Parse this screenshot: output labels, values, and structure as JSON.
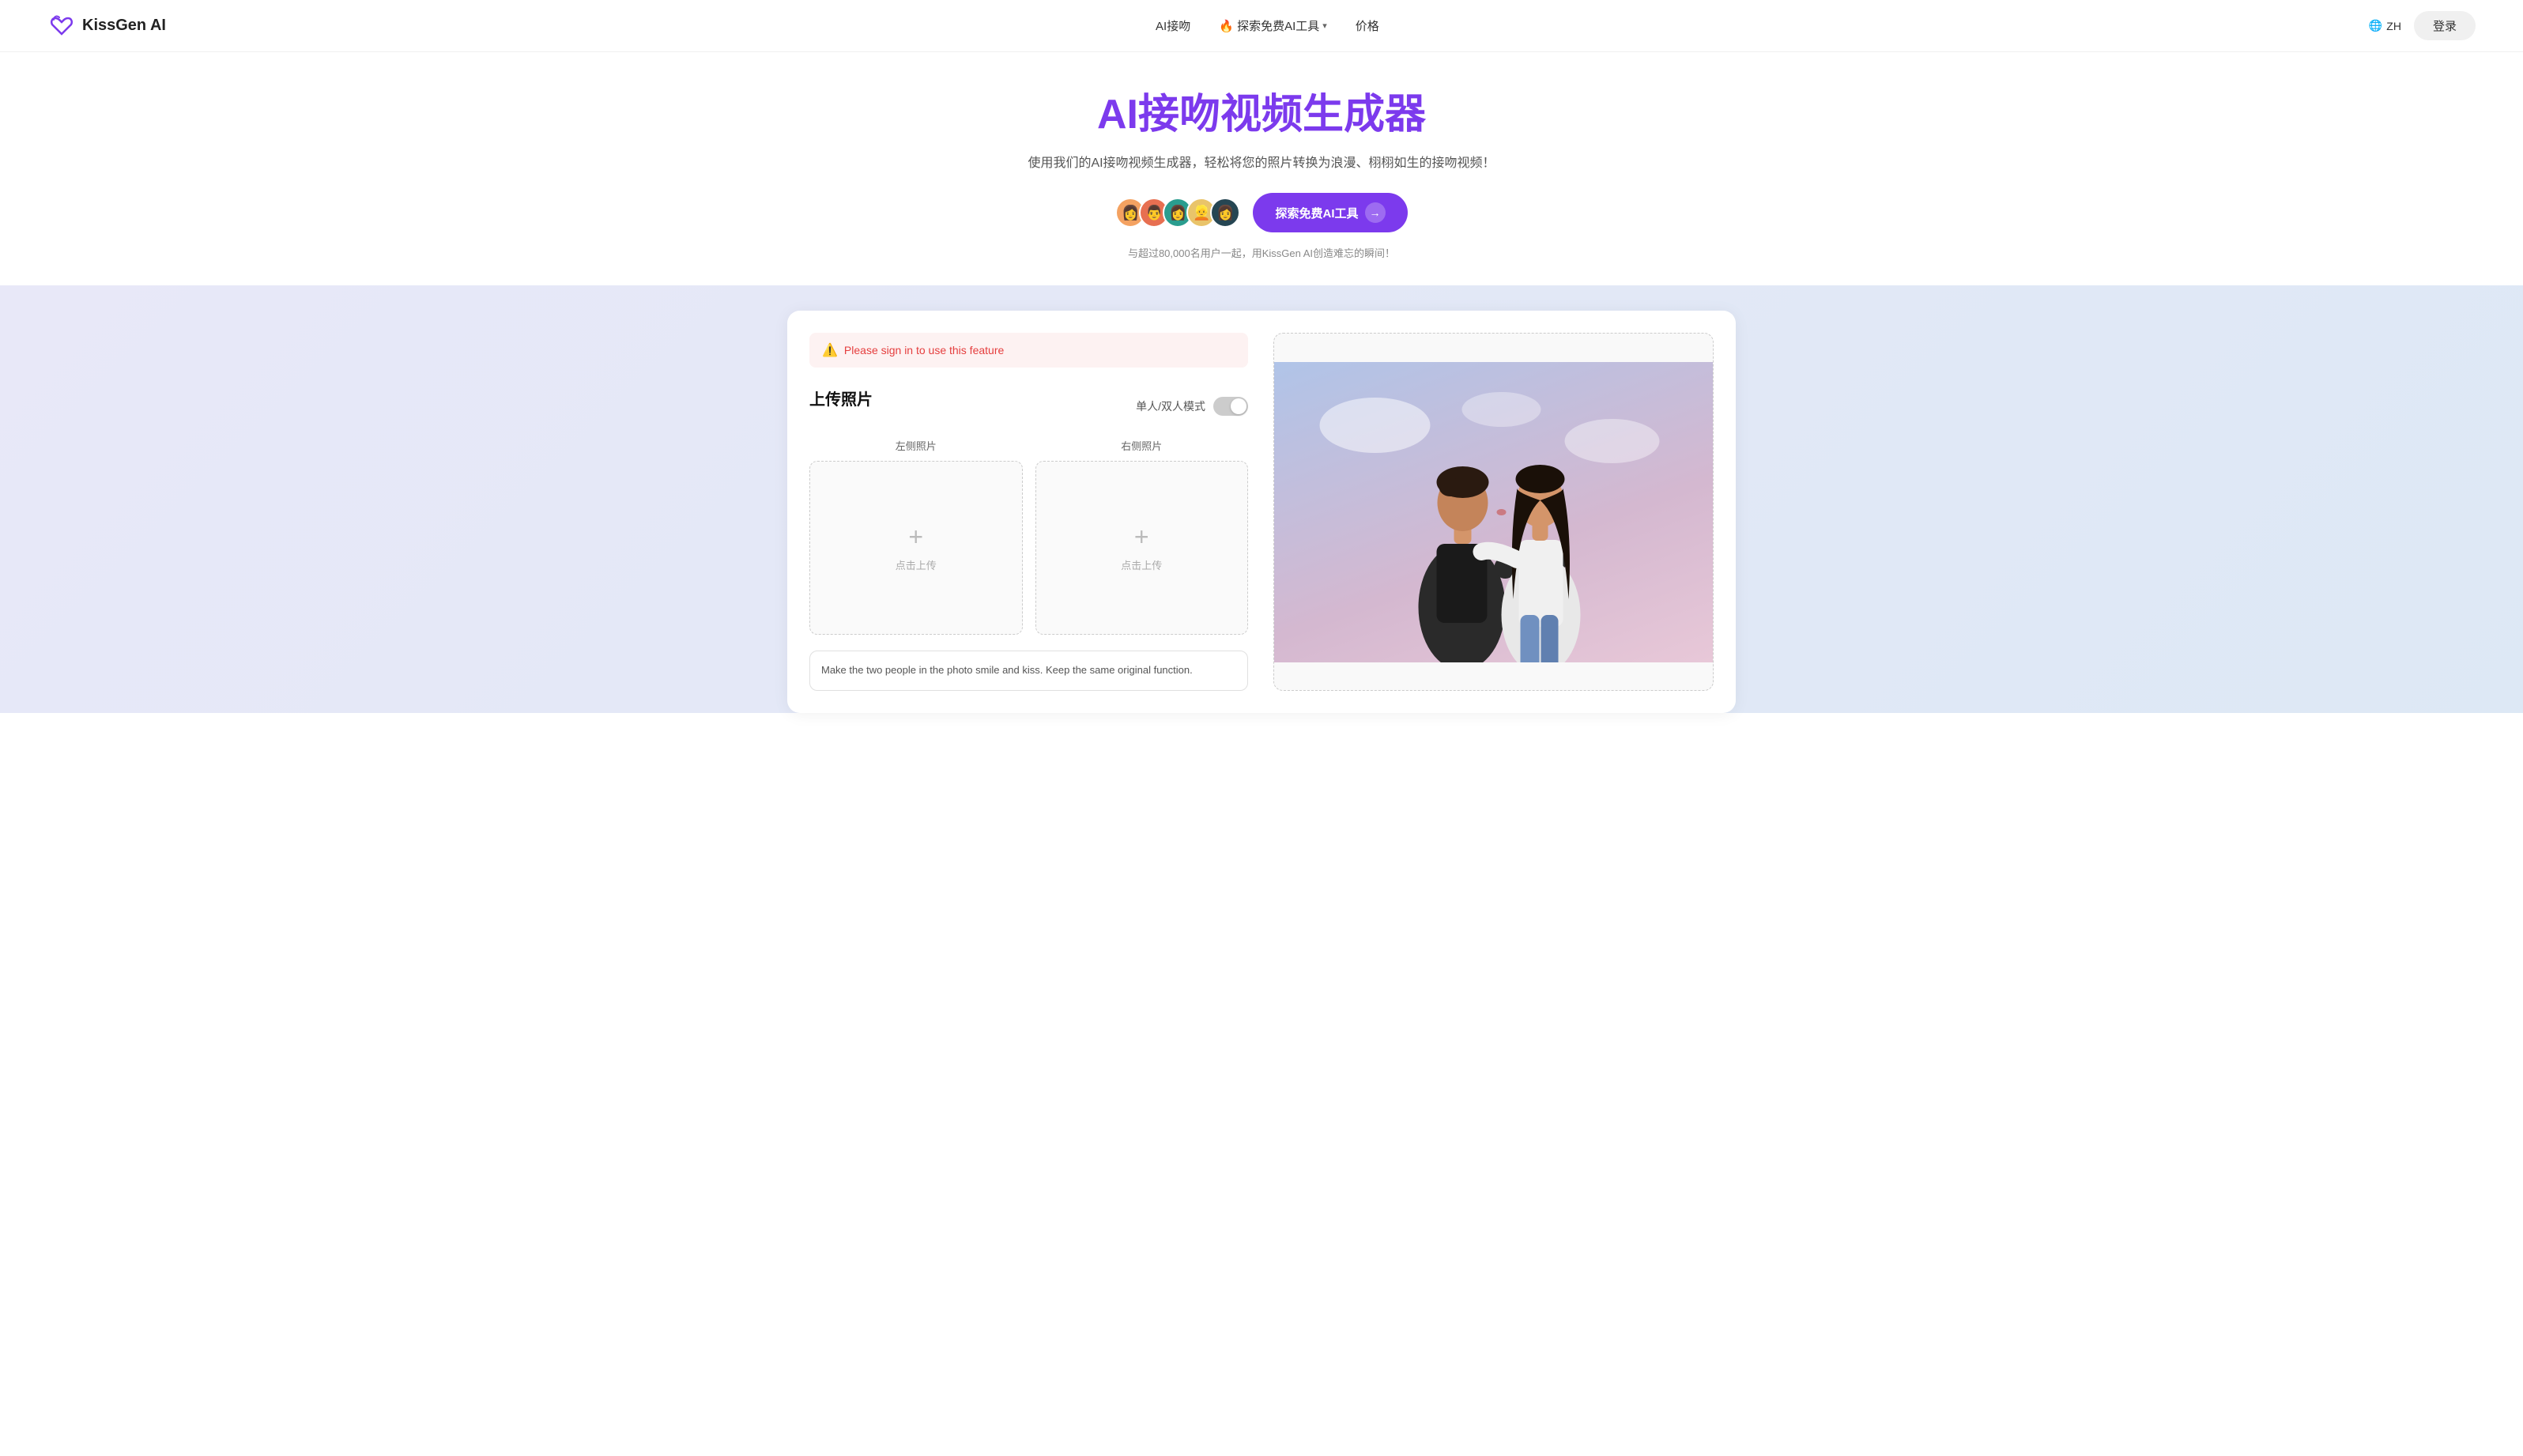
{
  "navbar": {
    "logo_text": "KissGen AI",
    "nav_items": [
      {
        "label": "AI接吻",
        "id": "ai-kiss",
        "has_chevron": false
      },
      {
        "label": "🔥 探索免费AI工具",
        "id": "explore",
        "has_chevron": true
      },
      {
        "label": "价格",
        "id": "price",
        "has_chevron": false
      }
    ],
    "lang": "ZH",
    "login_label": "登录"
  },
  "hero": {
    "title": "AI接吻视频生成器",
    "subtitle": "使用我们的AI接吻视频生成器，轻松将您的照片转换为浪漫、栩栩如生的接吻视频！",
    "cta_button": "探索免费AI工具",
    "user_count_text": "与超过80,000名用户一起，用KissGen AI创造难忘的瞬间！",
    "avatars": [
      "👩",
      "👨",
      "👩",
      "👱",
      "👩"
    ]
  },
  "tool": {
    "sign_in_alert": "Please sign in to use this feature",
    "upload_section_title": "上传照片",
    "toggle_label": "单人/双人模式",
    "left_photo_label": "左侧照片",
    "right_photo_label": "右侧照片",
    "upload_click_text": "点击上传",
    "prompt_text": "Make the two people in the photo smile and kiss. Keep the same original function."
  },
  "colors": {
    "primary": "#7c3aed",
    "alert_red": "#e53e3e",
    "alert_bg": "#fdf2f2"
  }
}
